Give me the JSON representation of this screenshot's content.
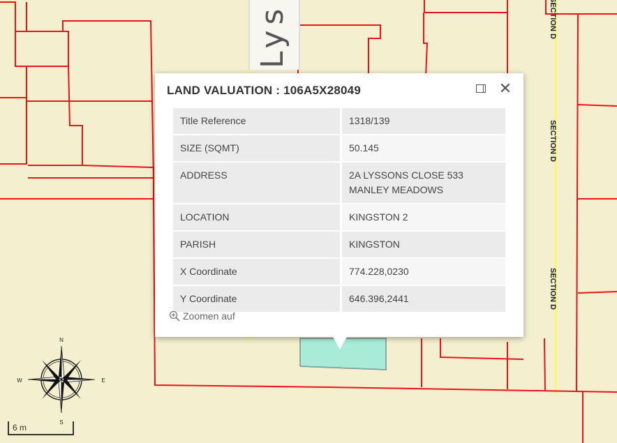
{
  "popup": {
    "title": "LAND VALUATION : 106A5X28049",
    "rows": [
      {
        "key": "Title Reference",
        "value": "1318/139"
      },
      {
        "key": "SIZE (SQMT)",
        "value": "50.145"
      },
      {
        "key": "ADDRESS",
        "value": "2A LYSSONS CLOSE 533 MANLEY MEADOWS"
      },
      {
        "key": "LOCATION",
        "value": "KINGSTON 2"
      },
      {
        "key": "PARISH",
        "value": "KINGSTON"
      },
      {
        "key": "X Coordinate",
        "value": "774.228,0230"
      },
      {
        "key": "Y Coordinate",
        "value": "646.396,2441"
      }
    ],
    "zoom_label": "Zoomen auf"
  },
  "map": {
    "street_label": "Lys",
    "section_labels": [
      "SECTION D",
      "SECTION D",
      "SECTION D"
    ],
    "parcel_color": "#ff0000",
    "background_color": "#f3efcf",
    "highlight_color": "#a8ecd8",
    "road_line_color": "#ffff00"
  },
  "scale": {
    "label": "6 m"
  },
  "compass": {
    "n": "N",
    "s": "S",
    "e": "E",
    "w": "W"
  }
}
